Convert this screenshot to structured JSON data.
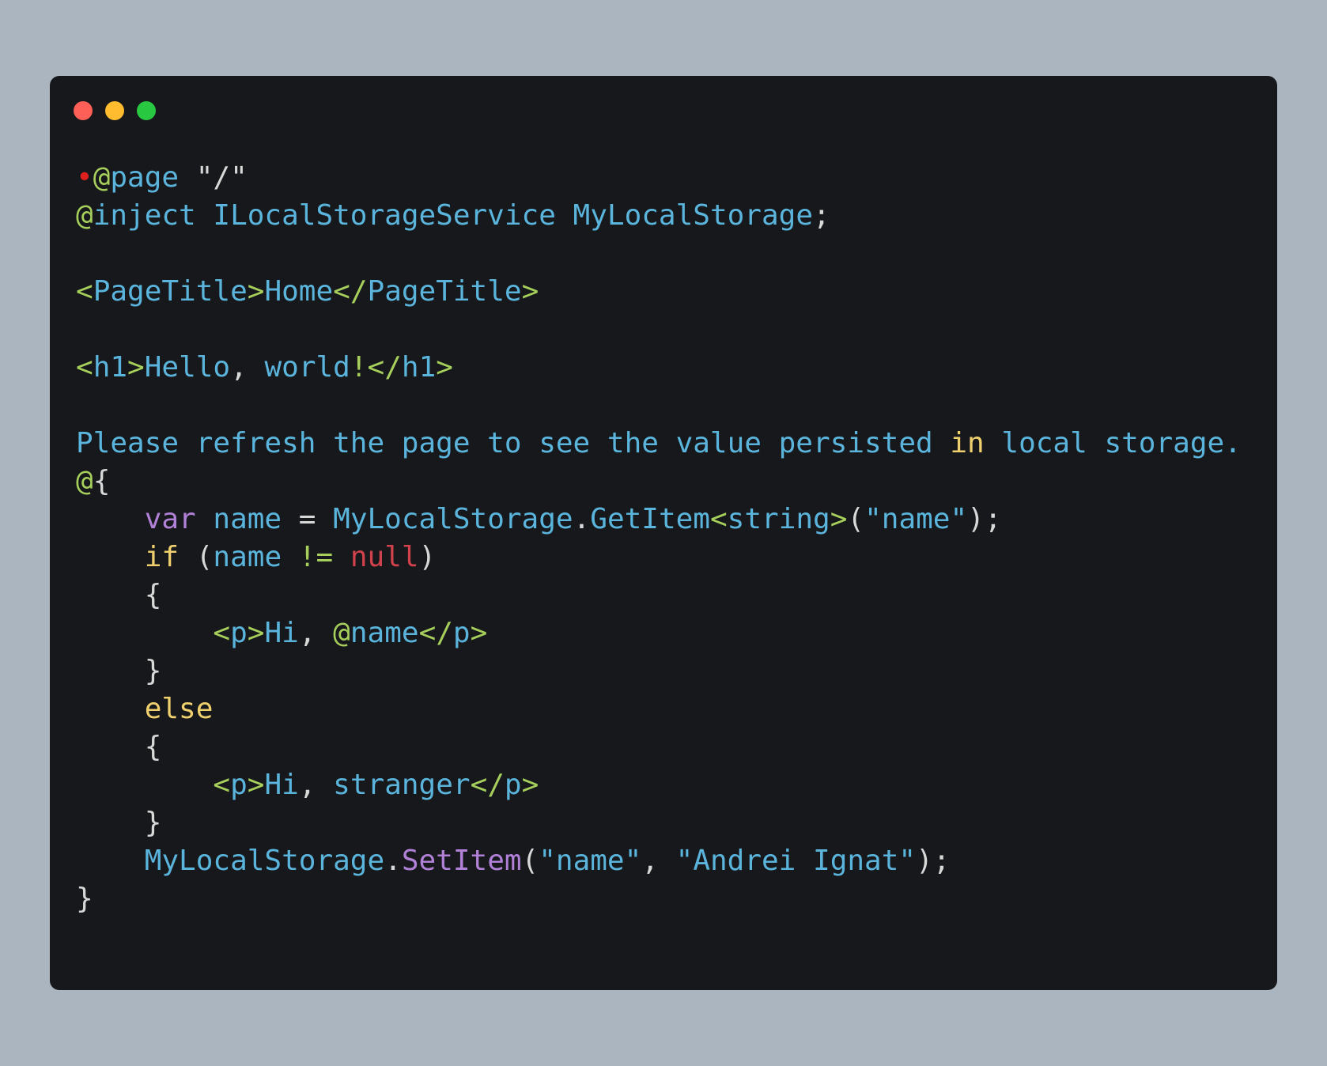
{
  "window": {
    "controls": [
      "close",
      "minimize",
      "maximize"
    ],
    "colors": {
      "close": "#fe5f57",
      "minimize": "#febc2e",
      "maximize": "#28c840"
    }
  },
  "theme": {
    "background": "#16181b",
    "page_background": "#abb5c0",
    "token_colors": {
      "blue": "#5ab4dc",
      "green": "#a6cf5b",
      "white": "#d8d8d8",
      "yellow": "#f0cf6e",
      "purple": "#b180d7",
      "red": "#d1424c",
      "marker": "#e01f1f"
    }
  },
  "code": {
    "lines": [
      [
        [
          "marker",
          "•"
        ],
        [
          "green",
          "@"
        ],
        [
          "blue",
          "page "
        ],
        [
          "white",
          "\"/\""
        ]
      ],
      [
        [
          "green",
          "@"
        ],
        [
          "blue",
          "inject ILocalStorageService MyLocalStorage"
        ],
        [
          "white",
          ";"
        ]
      ],
      [],
      [
        [
          "green",
          "<"
        ],
        [
          "blue",
          "PageTitle"
        ],
        [
          "green",
          ">"
        ],
        [
          "blue",
          "Home"
        ],
        [
          "green",
          "</"
        ],
        [
          "blue",
          "PageTitle"
        ],
        [
          "green",
          ">"
        ]
      ],
      [],
      [
        [
          "green",
          "<"
        ],
        [
          "blue",
          "h1"
        ],
        [
          "green",
          ">"
        ],
        [
          "blue",
          "Hello"
        ],
        [
          "white",
          ", "
        ],
        [
          "blue",
          "world"
        ],
        [
          "green",
          "!"
        ],
        [
          "green",
          "</"
        ],
        [
          "blue",
          "h1"
        ],
        [
          "green",
          ">"
        ]
      ],
      [],
      [
        [
          "blue",
          "Please refresh the page to see the value persisted "
        ],
        [
          "yellow",
          "in"
        ],
        [
          "blue",
          " local storage."
        ]
      ],
      [
        [
          "green",
          "@"
        ],
        [
          "white",
          "{"
        ]
      ],
      [
        [
          "white",
          "    "
        ],
        [
          "purple",
          "var"
        ],
        [
          "blue",
          " name "
        ],
        [
          "white",
          "= "
        ],
        [
          "blue",
          "MyLocalStorage"
        ],
        [
          "white",
          "."
        ],
        [
          "blue",
          "GetItem"
        ],
        [
          "green",
          "<"
        ],
        [
          "blue",
          "string"
        ],
        [
          "green",
          ">"
        ],
        [
          "white",
          "("
        ],
        [
          "blue",
          "\"name\""
        ],
        [
          "white",
          ");"
        ]
      ],
      [
        [
          "white",
          "    "
        ],
        [
          "yellow",
          "if"
        ],
        [
          "white",
          " ("
        ],
        [
          "blue",
          "name "
        ],
        [
          "green",
          "!="
        ],
        [
          "white",
          " "
        ],
        [
          "red",
          "null"
        ],
        [
          "white",
          ")"
        ]
      ],
      [
        [
          "white",
          "    {"
        ]
      ],
      [
        [
          "white",
          "        "
        ],
        [
          "green",
          "<"
        ],
        [
          "blue",
          "p"
        ],
        [
          "green",
          ">"
        ],
        [
          "blue",
          "Hi"
        ],
        [
          "white",
          ", "
        ],
        [
          "green",
          "@"
        ],
        [
          "blue",
          "name"
        ],
        [
          "green",
          "</"
        ],
        [
          "blue",
          "p"
        ],
        [
          "green",
          ">"
        ]
      ],
      [
        [
          "white",
          "    }"
        ]
      ],
      [
        [
          "white",
          "    "
        ],
        [
          "yellow",
          "else"
        ]
      ],
      [
        [
          "white",
          "    {"
        ]
      ],
      [
        [
          "white",
          "        "
        ],
        [
          "green",
          "<"
        ],
        [
          "blue",
          "p"
        ],
        [
          "green",
          ">"
        ],
        [
          "blue",
          "Hi"
        ],
        [
          "white",
          ", "
        ],
        [
          "blue",
          "stranger"
        ],
        [
          "green",
          "</"
        ],
        [
          "blue",
          "p"
        ],
        [
          "green",
          ">"
        ]
      ],
      [
        [
          "white",
          "    }"
        ]
      ],
      [
        [
          "white",
          "    "
        ],
        [
          "blue",
          "MyLocalStorage"
        ],
        [
          "white",
          "."
        ],
        [
          "purple",
          "SetItem"
        ],
        [
          "white",
          "("
        ],
        [
          "blue",
          "\"name\""
        ],
        [
          "white",
          ", "
        ],
        [
          "blue",
          "\"Andrei Ignat\""
        ],
        [
          "white",
          ");"
        ]
      ],
      [
        [
          "white",
          "}"
        ]
      ]
    ]
  }
}
